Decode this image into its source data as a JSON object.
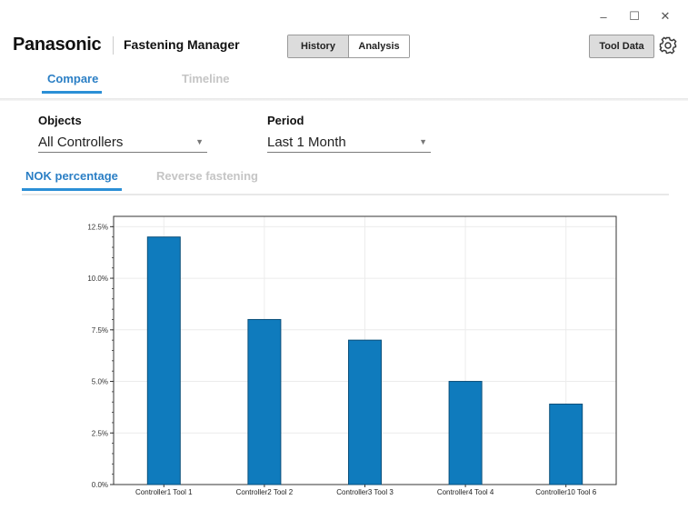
{
  "window": {
    "minimize_glyph": "–",
    "maximize_glyph": "☐",
    "close_glyph": "✕"
  },
  "header": {
    "brand": "Panasonic",
    "app_title": "Fastening Manager",
    "modes": [
      "History",
      "Analysis"
    ],
    "active_mode": "History",
    "tool_data_label": "Tool Data",
    "settings_icon": "gear-icon"
  },
  "main_tabs": [
    {
      "label": "Compare",
      "active": true
    },
    {
      "label": "Timeline",
      "active": false
    }
  ],
  "filters": {
    "objects_label": "Objects",
    "objects_value": "All Controllers",
    "period_label": "Period",
    "period_value": "Last 1 Month"
  },
  "sub_tabs": [
    {
      "label": "NOK percentage",
      "active": true
    },
    {
      "label": "Reverse fastening",
      "active": false
    }
  ],
  "colors": {
    "accent": "#2b8fd6",
    "bar": "#0f7bbd",
    "inactive_tab": "#c5c5c5"
  },
  "chart_data": {
    "type": "bar",
    "categories": [
      "Controller1 Tool 1",
      "Controller2 Tool 2",
      "Controller3 Tool 3",
      "Controller4 Tool 4",
      "Controller10 Tool 6"
    ],
    "values": [
      12.0,
      8.0,
      7.0,
      5.0,
      3.9
    ],
    "title": "",
    "xlabel": "",
    "ylabel": "",
    "ylim": [
      0,
      13.0
    ],
    "yticks": [
      0,
      2.5,
      5.0,
      7.5,
      10.0,
      12.5
    ],
    "ytick_labels": [
      "0.0%",
      "2.5%",
      "5.0%",
      "7.5%",
      "10.0%",
      "12.5%"
    ],
    "grid": true,
    "legend": "none"
  }
}
